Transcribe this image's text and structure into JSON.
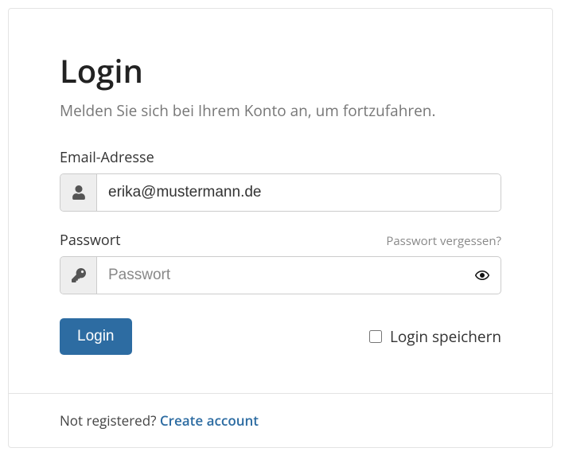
{
  "title": "Login",
  "subtitle": "Melden Sie sich bei Ihrem Konto an, um fortzufahren.",
  "email": {
    "label": "Email-Adresse",
    "value": "erika@mustermann.de"
  },
  "password": {
    "label": "Passwort",
    "placeholder": "Passwort",
    "forgot": "Passwort vergessen?"
  },
  "login_button": "Login",
  "remember_label": "Login speichern",
  "footer": {
    "text": "Not registered? ",
    "link": "Create account"
  }
}
